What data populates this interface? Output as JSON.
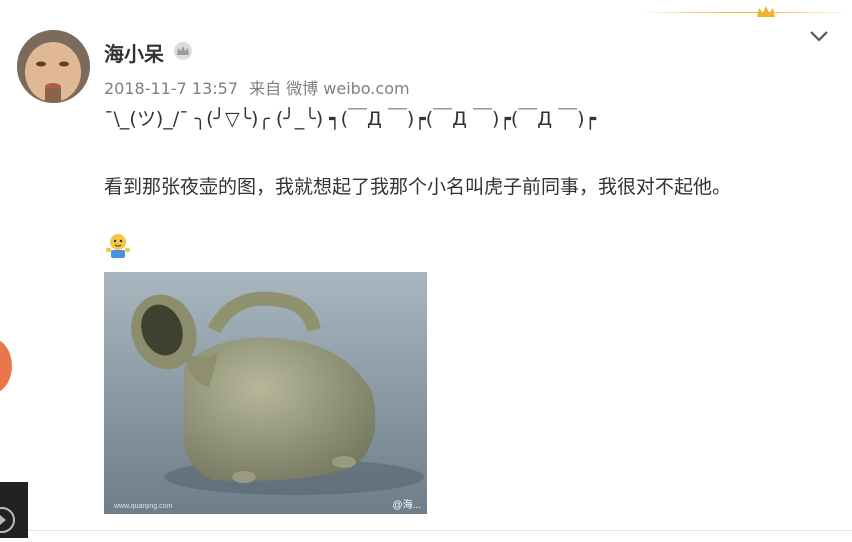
{
  "post": {
    "username": "海小呆",
    "timestamp": "2018-11-7 13:57",
    "source": "来自 微博 weibo.com",
    "kaomoji": "¯\\_(ツ)_/¯ ╮(╯▽╰)╭ (╯_╰) ┑(￣Д ￣)┍(￣Д ￣)┍(￣Д ￣)┍",
    "text": "看到那张夜壶的图，我就想起了我那个小名叫虎子前同事，我很对不起他。",
    "image_watermark_left": "www.quanjing.com",
    "image_watermark_right": "@海..."
  },
  "icons": {
    "crown": "crown-icon",
    "vip": "vip-crown-icon",
    "chevron": "chevron-down-icon",
    "emoji": "shrug-emoji-icon"
  },
  "colors": {
    "accent_gold": "#f0b428",
    "meta_gray": "#808080",
    "side_orange": "#e8784b"
  }
}
